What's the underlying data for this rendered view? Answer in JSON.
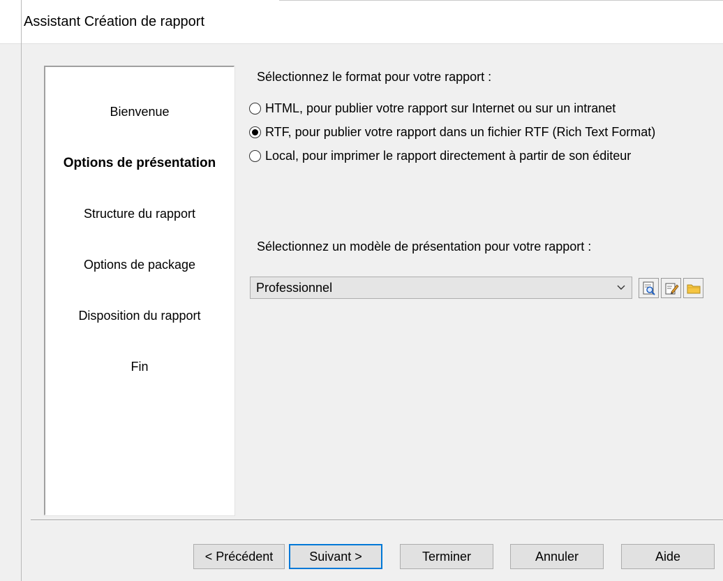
{
  "window": {
    "title": "Assistant Création de rapport"
  },
  "steps": [
    {
      "label": "Bienvenue",
      "active": false
    },
    {
      "label": "Options de présentation",
      "active": true
    },
    {
      "label": "Structure du rapport",
      "active": false
    },
    {
      "label": "Options de package",
      "active": false
    },
    {
      "label": "Disposition du rapport",
      "active": false
    },
    {
      "label": "Fin",
      "active": false
    }
  ],
  "format": {
    "prompt": "Sélectionnez le format pour votre rapport :",
    "options": [
      {
        "label": "HTML, pour publier votre rapport sur Internet ou sur un intranet",
        "selected": false
      },
      {
        "label": "RTF, pour publier votre rapport dans un fichier RTF (Rich Text Format)",
        "selected": true
      },
      {
        "label": "Local, pour imprimer le rapport directement à partir de son éditeur",
        "selected": false
      }
    ]
  },
  "template": {
    "prompt": "Sélectionnez un modèle de présentation pour votre rapport :",
    "selected": "Professionnel",
    "tools": [
      "preview-icon",
      "edit-icon",
      "folder-icon"
    ]
  },
  "buttons": {
    "previous": "< Précédent",
    "next": "Suivant >",
    "finish": "Terminer",
    "cancel": "Annuler",
    "help": "Aide"
  },
  "colors": {
    "focus_border": "#0078d7",
    "folder": "#f5c542"
  }
}
